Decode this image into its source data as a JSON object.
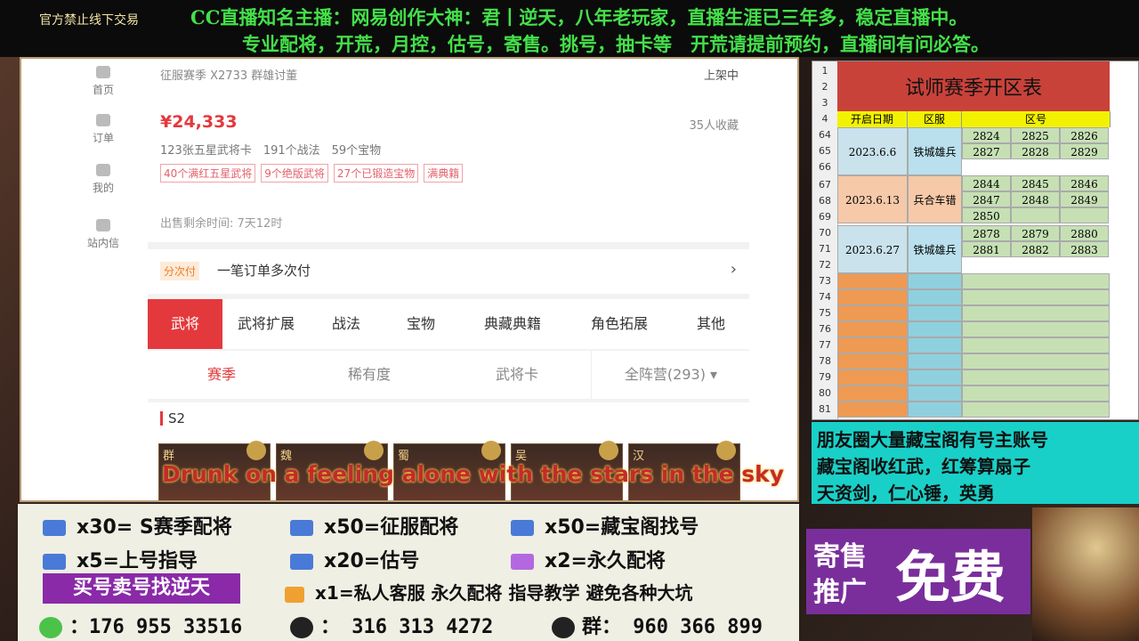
{
  "ticker": {
    "tag": "官方禁止线下交易",
    "line1": "CC直播知名主播：网易创作大神：君丨逆天，八年老玩家，直播生涯已三年多，稳定直播中。",
    "line2": "专业配将，开荒，月控，估号，寄售。挑号，抽卡等　开荒请提前预约，直播间有问必答。"
  },
  "nav": [
    {
      "label": "首页",
      "icon": "home-icon"
    },
    {
      "label": "订单",
      "icon": "order-icon"
    },
    {
      "label": "我的",
      "icon": "user-icon"
    },
    {
      "label": "站内信",
      "icon": "mail-icon"
    }
  ],
  "listing": {
    "subtitle": "征服赛季 X2733 群雄讨董",
    "status": "上架中",
    "price": "¥24,333",
    "favorites": "35人收藏",
    "stats": "123张五星武将卡　191个战法　59个宝物",
    "tags": [
      "40个满红五星武将",
      "9个绝版武将",
      "27个已锻造宝物",
      "满典籍"
    ],
    "remaining": "出售剩余时间: 7天12时"
  },
  "installment": {
    "badge": "分次付",
    "text": "一笔订单多次付",
    "arrow": "›"
  },
  "tabs": [
    "武将",
    "武将扩展",
    "战法",
    "宝物",
    "典藏典籍",
    "角色拓展",
    "其他"
  ],
  "filters": [
    "赛季",
    "稀有度",
    "武将卡",
    "全阵营(293) ▾"
  ],
  "season": {
    "label": "S2",
    "cards": [
      "群",
      "魏",
      "蜀",
      "吴",
      "汉"
    ]
  },
  "caption": "Drunk on a feeling alone with the stars in the sky",
  "sheet": {
    "title": "试师赛季开区表",
    "headers": [
      "开启日期",
      "区服",
      "区号"
    ],
    "rownums": [
      "1",
      "2",
      "3",
      "4",
      "64",
      "65",
      "66",
      "67",
      "68",
      "69",
      "70",
      "71",
      "72",
      "73",
      "74",
      "75",
      "76",
      "77",
      "78",
      "79",
      "80",
      "81"
    ],
    "groups": [
      {
        "date": "2023.6.6",
        "server": "铁城雄兵",
        "nums": [
          "2824",
          "2825",
          "2826",
          "2827",
          "2828",
          "2829"
        ]
      },
      {
        "date": "2023.6.13",
        "server": "兵合车错",
        "nums": [
          "2844",
          "2845",
          "2846",
          "2847",
          "2848",
          "2849",
          "2850"
        ]
      },
      {
        "date": "2023.6.27",
        "server": "铁城雄兵",
        "nums": [
          "2878",
          "2879",
          "2880",
          "2881",
          "2882",
          "2883"
        ]
      }
    ]
  },
  "promo": [
    "朋友圈大量藏宝阁有号主账号",
    "藏宝阁收红武，红筹算扇子",
    "天资剑，仁心锤，英勇"
  ],
  "consign": {
    "line1": "寄售",
    "line2": "推广",
    "free": "免费"
  },
  "services": [
    "x30= S赛季配将",
    "x50=征服配将",
    "x50=藏宝阁找号",
    "x5=上号指导",
    "x20=估号",
    "x2=永久配将",
    "x1=私人客服 永久配将  指导教学 避免各种大坑"
  ],
  "buysell": "买号卖号找逆天",
  "contacts": {
    "wechat": "：176 955 33516",
    "qq": "：  316 313 4272",
    "group": "群： 960 366 899"
  },
  "colors": {
    "accent": "#e4393c",
    "ticker": "#44e04a",
    "promo": "#19d0c8",
    "consign": "#7a2e9b"
  }
}
